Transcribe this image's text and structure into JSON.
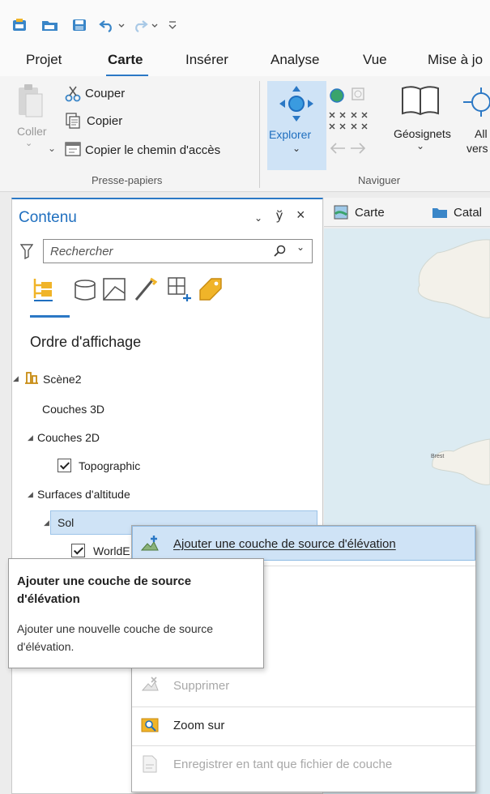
{
  "ribbon": {
    "tabs": [
      "Projet",
      "Carte",
      "Insérer",
      "Analyse",
      "Vue",
      "Mise à jo"
    ],
    "active_tab": "Carte",
    "clipboard": {
      "paste_label": "Coller",
      "cut_label": "Couper",
      "copy_label": "Copier",
      "copy_path_label": "Copier le chemin d'accès",
      "group_label": "Presse-papiers"
    },
    "navigate": {
      "explore_label": "Explorer",
      "bookmarks_label": "Géosignets",
      "goto_label_line1": "All",
      "goto_label_line2": "vers",
      "group_label": "Naviguer"
    }
  },
  "contents_pane": {
    "title": "Contenu",
    "search": {
      "placeholder": "Rechercher"
    },
    "section_title": "Ordre d'affichage",
    "scene_label": "Scène2",
    "layers_3d": "Couches 3D",
    "layers_2d": "Couches 2D",
    "topographic": "Topographic",
    "elevation_surfaces": "Surfaces d'altitude",
    "ground": "Sol",
    "world_elevation_partial": "WorldE"
  },
  "map_view": {
    "tabs": [
      "Carte",
      "Catal"
    ],
    "map_labels": [
      "Brest"
    ]
  },
  "context_menu": {
    "items": [
      {
        "label": "Ajouter une couche de source d'élévation",
        "enabled": true,
        "highlighted": true
      },
      {
        "label": "Supprimer",
        "enabled": false
      },
      {
        "label": "Zoom sur",
        "enabled": true
      },
      {
        "label": "Enregistrer en tant que fichier de couche",
        "enabled": false
      }
    ]
  },
  "tooltip": {
    "title": "Ajouter une couche de source d'élévation",
    "description": "Ajouter une nouvelle couche de source d'élévation."
  },
  "colors": {
    "accent": "#2b78c5",
    "selection": "#cfe3f6",
    "title_blue": "#1f6fbf"
  }
}
